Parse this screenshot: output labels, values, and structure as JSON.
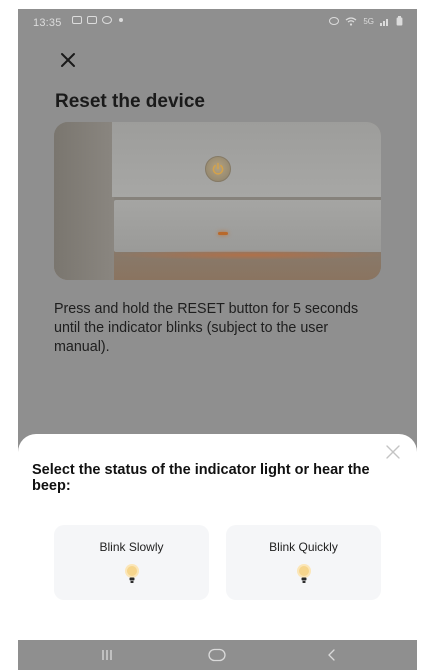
{
  "status_bar": {
    "time": "13:35",
    "network": "5G",
    "icons": [
      "message-icon",
      "chat-icon",
      "app-icon",
      "alarm-icon",
      "wifi-icon",
      "signal-icon",
      "battery-icon"
    ]
  },
  "header": {
    "close_icon": "close-icon",
    "title": "Reset the device"
  },
  "device_image": {
    "description_icon": "device-reset-photo"
  },
  "instructions": "Press and hold the RESET button for 5 seconds until the indicator blinks (subject to the user manual).",
  "sheet": {
    "title": "Select the status of the indicator light or hear the beep:",
    "close_icon": "close-icon",
    "options": [
      {
        "label": "Blink Slowly",
        "icon": "bulb-icon"
      },
      {
        "label": "Blink Quickly",
        "icon": "bulb-icon"
      }
    ]
  },
  "nav_bar": {
    "buttons": [
      "recents-icon",
      "home-icon",
      "back-icon"
    ]
  },
  "colors": {
    "overlay": "#8f8f8f",
    "sheet": "#ffffff",
    "card": "#f5f6f8",
    "bulb_glow": "#f6d58c"
  }
}
